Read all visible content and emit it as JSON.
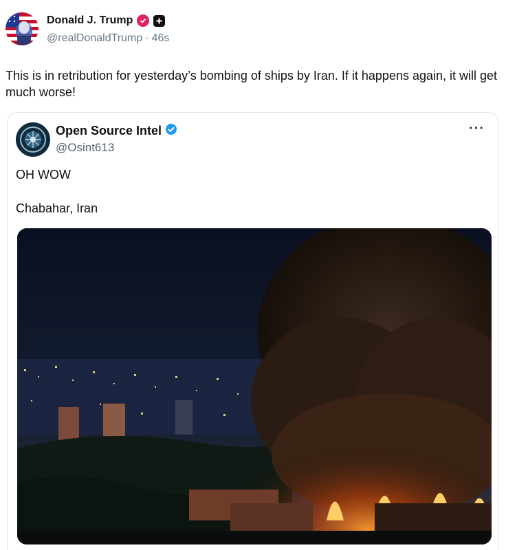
{
  "post": {
    "display_name": "Donald J. Trump",
    "handle": "@realDonaldTrump",
    "separator": "·",
    "time": "46s",
    "text": "This is in retribution for yesterday’s bombing of ships by Iran. If it happens again, it will get much worse!",
    "icons": {
      "avatar": "flag-portrait-avatar",
      "verified": "verified-badge-icon",
      "plus": "plus-badge-icon"
    },
    "colors": {
      "verified": "#e0245e",
      "plus": "#111111"
    }
  },
  "quote": {
    "display_name": "Open Source Intel",
    "handle": "@Osint613",
    "more": "···",
    "line1": "OH WOW",
    "line2": "Chabahar, Iran",
    "icons": {
      "avatar": "intel-emblem-avatar",
      "verified": "blue-check-icon",
      "media": "night-fire-photo"
    },
    "colors": {
      "verified": "#1d9bf0"
    }
  }
}
